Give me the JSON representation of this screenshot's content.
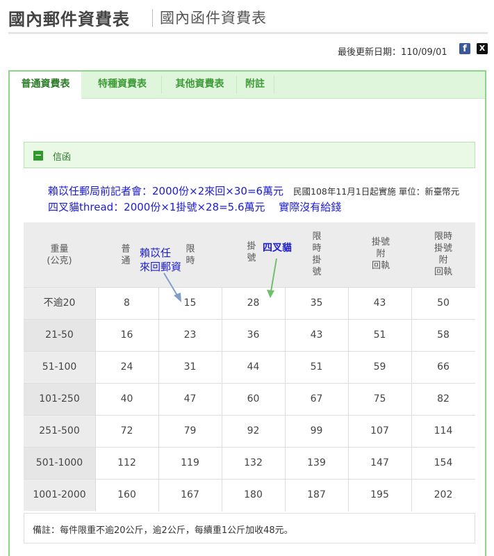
{
  "header": {
    "title": "國內郵件資費表",
    "subtitle": "國內函件資費表"
  },
  "update": {
    "text": "最後更新日期：110/09/01"
  },
  "social": {
    "facebook": "f",
    "x": "X"
  },
  "tabs": [
    {
      "label": "普通資費表"
    },
    {
      "label": "特種資費表"
    },
    {
      "label": "其他資費表"
    },
    {
      "label": "附註"
    }
  ],
  "section": {
    "toggle": "−",
    "label": "信函"
  },
  "notes": {
    "line1": "賴苡任郵局前記者會：2000份×2來回×30=6萬元",
    "line2": "四叉貓thread：2000份×1掛號×28=5.6萬元　 實際沒有給錢",
    "info": "民國108年11月1日起實施 單位：新臺幣元"
  },
  "annotations": {
    "blue_line1": "賴苡任",
    "blue_line2": "來回郵資",
    "green": "四叉貓"
  },
  "table": {
    "headers": [
      [
        "重量",
        "(公克)"
      ],
      [
        "普",
        "通"
      ],
      [
        "限",
        "時"
      ],
      [
        "掛",
        "號"
      ],
      [
        "限",
        "時",
        "掛",
        "號"
      ],
      [
        "掛號",
        "附",
        "回執"
      ],
      [
        "限時",
        "掛號",
        "附",
        "回執"
      ]
    ],
    "rows": [
      [
        "不逾20",
        "8",
        "15",
        "28",
        "35",
        "43",
        "50"
      ],
      [
        "21-50",
        "16",
        "23",
        "36",
        "43",
        "51",
        "58"
      ],
      [
        "51-100",
        "24",
        "31",
        "44",
        "51",
        "59",
        "66"
      ],
      [
        "101-250",
        "40",
        "47",
        "60",
        "67",
        "75",
        "82"
      ],
      [
        "251-500",
        "72",
        "79",
        "92",
        "99",
        "107",
        "114"
      ],
      [
        "501-1000",
        "112",
        "119",
        "132",
        "139",
        "147",
        "154"
      ],
      [
        "1001-2000",
        "160",
        "167",
        "180",
        "187",
        "195",
        "202"
      ]
    ]
  },
  "footnote": "備註：每件限重不逾20公斤，逾2公斤，每續重1公斤加收48元。",
  "colors": {
    "accent": "#3f9b3a",
    "tab_bg": "#dff5dc",
    "annotation": "#1b1bd0",
    "arrow_blue": "#7f9fc8",
    "arrow_green": "#6fbf6b"
  }
}
